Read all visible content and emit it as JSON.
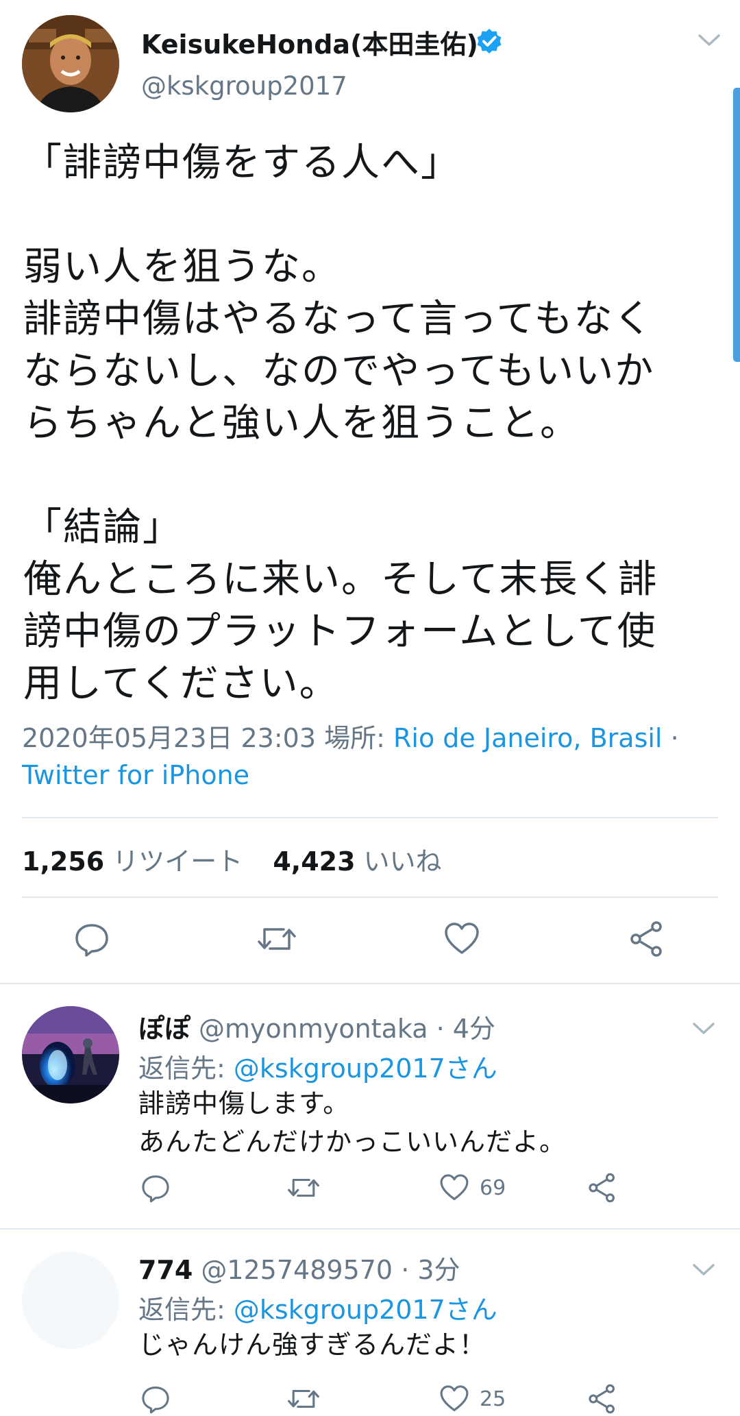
{
  "main_tweet": {
    "author_name": "KeisukeHonda(本田圭佑)",
    "author_handle": "@kskgroup2017",
    "verified_icon": "verified-badge-icon",
    "text": "「誹謗中傷をする人へ」\n\n弱い人を狙うな。\n誹謗中傷はやるなって言ってもなく\nならないし、なのでやってもいいか\nらちゃんと強い人を狙うこと。\n\n「結論」\n俺んところに来い。そして末長く誹\n謗中傷のプラットフォームとして使\n用してください。",
    "timestamp": "2020年05月23日 23:03",
    "location_label": "場所:",
    "location": "Rio de Janeiro, Brasil",
    "separator": "·",
    "source": "Twitter for iPhone",
    "retweet_count": "1,256",
    "retweet_label": "リツイート",
    "like_count": "4,423",
    "like_label": "いいね"
  },
  "replies": [
    {
      "name": "ぽぽ",
      "handle": "@myonmyontaka",
      "time": "· 4分",
      "reply_to_label": "返信先:",
      "reply_to": "@kskgroup2017さん",
      "text": "誹謗中傷します。\nあんたどんだけかっこいいんだよ。",
      "like_count": "69"
    },
    {
      "name": "774",
      "handle": "@1257489570",
      "time": "· 3分",
      "reply_to_label": "返信先:",
      "reply_to": "@kskgroup2017さん",
      "text": "じゃんけん強すぎるんだよ！",
      "like_count": "25"
    }
  ],
  "colors": {
    "primary_text": "#14171a",
    "secondary_text": "#657786",
    "link": "#1b95e0",
    "verified": "#1da1f2",
    "divider": "#e1e8ed"
  }
}
